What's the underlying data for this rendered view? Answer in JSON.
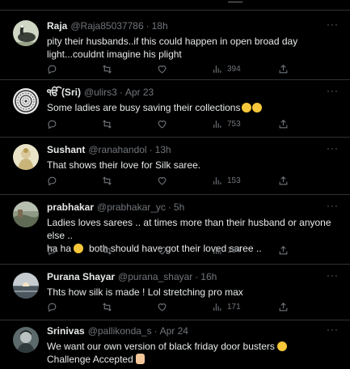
{
  "tweets": [
    {
      "name": "Raja",
      "handle": "@Raja85037786",
      "time": "18h",
      "text": "pity their husbands..if this could happen in open broad day light...couldnt imagine his plight",
      "views": "394",
      "avatar": "goose"
    },
    {
      "name": "ੴ (Sri)",
      "handle": "@ulirs3",
      "time": "Apr 23",
      "text": "Some ladies are busy saving their collections",
      "emoji": [
        "laughing-tears",
        "laughing-tears"
      ],
      "views": "753",
      "avatar": "mandala"
    },
    {
      "name": "Sushant",
      "handle": "@ranahandol",
      "time": "13h",
      "text": "That shows their love for Silk saree.",
      "views": "153",
      "avatar": "deity"
    },
    {
      "name": "prabhakar",
      "handle": "@prabhakar_yc",
      "time": "5h",
      "text_line1": "Ladies loves sarees .. at times more than their husband or anyone else ..",
      "text_line2a": "ha ha",
      "text_line2b": "both should have got their loved saree ..",
      "views": "154",
      "avatar": "landscape"
    },
    {
      "name": "Purana Shayar",
      "handle": "@purana_shayar",
      "time": "16h",
      "text": "Thts how silk is made ! Lol stretching pro max",
      "views": "171",
      "avatar": "sunset"
    },
    {
      "name": "Srinivas",
      "handle": "@pallikonda_s",
      "time": "Apr 24",
      "text_line1": "We want our own version of black friday door busters",
      "text_line2": "Challenge Accepted",
      "avatar": "portrait"
    }
  ],
  "colors": {
    "background": "#000000",
    "text": "#e7e9ea",
    "muted": "#71767b",
    "divider": "#2f3336"
  },
  "icons": [
    "reply-icon",
    "retweet-icon",
    "like-icon",
    "views-icon",
    "share-icon",
    "more-icon"
  ]
}
